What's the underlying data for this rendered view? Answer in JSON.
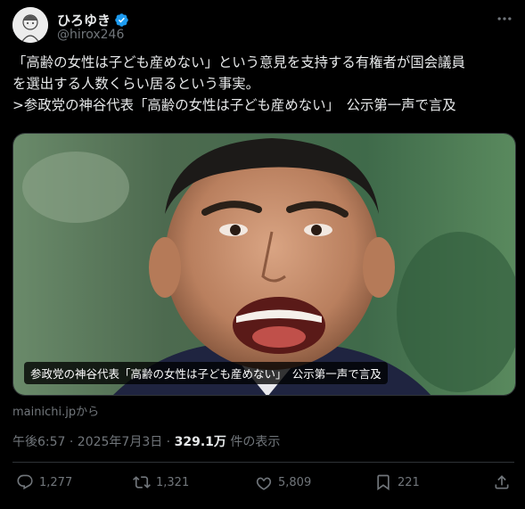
{
  "user": {
    "display_name": "ひろゆき",
    "handle": "@hirox246"
  },
  "tweet": {
    "text": "「高齢の女性は子ども産めない」という意見を支持する有権者が国会議員\nを選出する人数くらい居るという事実。\n>参政党の神谷代表「高齢の女性は子ども産めない」　公示第一声で言及"
  },
  "media": {
    "caption": "参政党の神谷代表「高齢の女性は子ども産めない」　公示第一声で言及",
    "source": "mainichi.jpから"
  },
  "meta": {
    "timestamp": "午後6:57 · 2025年7月3日 · ",
    "views_count": "329.1万",
    "views_label": " 件の表示"
  },
  "actions": {
    "replies": "1,277",
    "retweets": "1,321",
    "likes": "5,809",
    "bookmarks": "221"
  },
  "colors": {
    "background": "#000000",
    "text": "#e7e9ea",
    "secondary": "#71767b",
    "verified": "#1d9bf0",
    "divider": "#2f3336"
  }
}
